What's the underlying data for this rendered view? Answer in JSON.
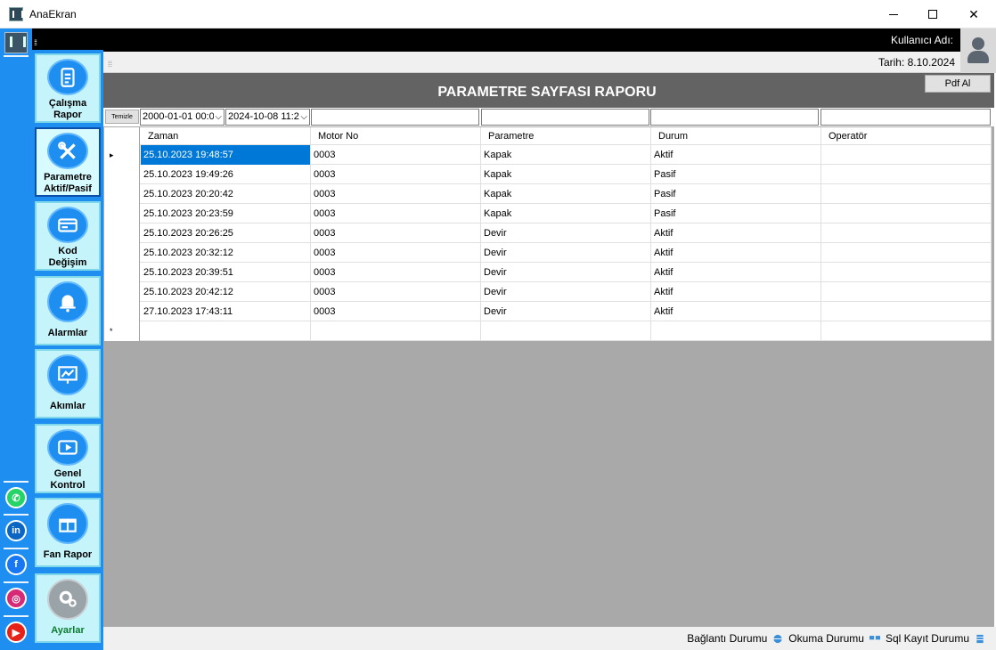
{
  "window": {
    "title": "AnaEkran"
  },
  "topbar": {
    "user_label": "Kullanıcı Adı:"
  },
  "datebar": {
    "date_label": "Tarih: 8.10.2024"
  },
  "menu": {
    "items": [
      {
        "label1": "Çalışma",
        "label2": "Rapor",
        "icon": "report-icon"
      },
      {
        "label1": "Parametre",
        "label2": "Aktif/Pasif",
        "icon": "tools-icon"
      },
      {
        "label1": "Kod",
        "label2": "Değişim",
        "icon": "card-icon"
      },
      {
        "label1": "Alarmlar",
        "label2": "",
        "icon": "bell-icon"
      },
      {
        "label1": "Akımlar",
        "label2": "",
        "icon": "chart-icon"
      },
      {
        "label1": "Genel",
        "label2": "Kontrol",
        "icon": "video-icon"
      },
      {
        "label1": "Fan Rapor",
        "label2": "",
        "icon": "gift-icon"
      },
      {
        "label1": "Ayarlar",
        "label2": "",
        "icon": "gear-icon"
      }
    ]
  },
  "social": [
    "whatsapp-icon",
    "linkedin-icon",
    "facebook-icon",
    "instagram-icon",
    "youtube-icon"
  ],
  "report": {
    "title": "PARAMETRE SAYFASI RAPORU",
    "pdf_button": "Pdf Al",
    "clear_button": "Temizle",
    "date_from": "2000-01-01 00:0",
    "date_to": "2024-10-08 11:2"
  },
  "grid": {
    "columns": [
      "Zaman",
      "Motor No",
      "Parametre",
      "Durum",
      "Operatör"
    ],
    "rows": [
      [
        "25.10.2023 19:48:57",
        "0003",
        "Kapak",
        "Aktif",
        ""
      ],
      [
        "25.10.2023 19:49:26",
        "0003",
        "Kapak",
        "Pasif",
        ""
      ],
      [
        "25.10.2023 20:20:42",
        "0003",
        "Kapak",
        "Pasif",
        ""
      ],
      [
        "25.10.2023 20:23:59",
        "0003",
        "Kapak",
        "Pasif",
        ""
      ],
      [
        "25.10.2023 20:26:25",
        "0003",
        "Devir",
        "Aktif",
        ""
      ],
      [
        "25.10.2023 20:32:12",
        "0003",
        "Devir",
        "Aktif",
        ""
      ],
      [
        "25.10.2023 20:39:51",
        "0003",
        "Devir",
        "Aktif",
        ""
      ],
      [
        "25.10.2023 20:42:12",
        "0003",
        "Devir",
        "Aktif",
        ""
      ],
      [
        "27.10.2023 17:43:11",
        "0003",
        "Devir",
        "Aktif",
        ""
      ]
    ],
    "selected_row": 0,
    "current_marker": "▸",
    "new_row_marker": "*"
  },
  "status": {
    "connection": "Bağlantı Durumu",
    "reading": "Okuma Durumu",
    "sql": "Sql Kayıt Durumu"
  }
}
